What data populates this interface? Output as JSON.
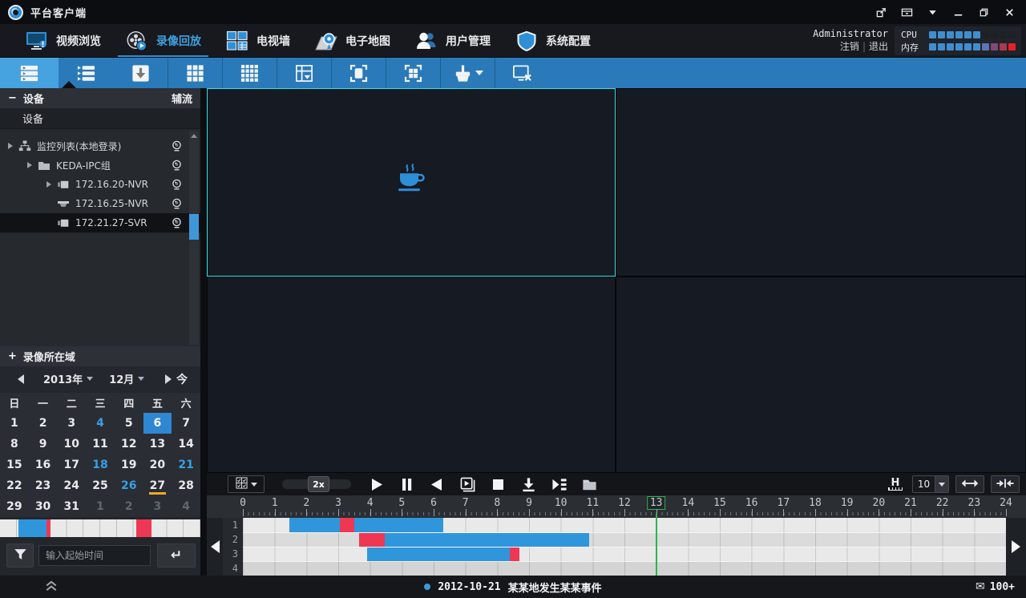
{
  "window": {
    "title": "平台客户端"
  },
  "titlebar": {
    "icons": [
      "popout",
      "panel-toggle",
      "caret-down",
      "minimize",
      "restore",
      "close"
    ]
  },
  "nav": {
    "tabs": [
      {
        "id": "video-browse",
        "label": "视频浏览",
        "icon": "monitor-icon",
        "active": false
      },
      {
        "id": "playback",
        "label": "录像回放",
        "icon": "film-reel-icon",
        "active": true
      },
      {
        "id": "tv-wall",
        "label": "电视墙",
        "icon": "tv-wall-icon",
        "active": false
      },
      {
        "id": "emap",
        "label": "电子地图",
        "icon": "map-pin-icon",
        "active": false
      },
      {
        "id": "user-mgmt",
        "label": "用户管理",
        "icon": "user-icon",
        "active": false
      },
      {
        "id": "sys-config",
        "label": "系统配置",
        "icon": "shield-icon",
        "active": false
      }
    ],
    "user": {
      "name": "Administrator",
      "logout": "注销",
      "divider": "|",
      "exit": "退出"
    },
    "perf": {
      "cpu_label": "CPU",
      "mem_label": "内存",
      "cpu_segments": [
        "#3e8ed0",
        "#3e8ed0",
        "#3e8ed0",
        "#3e8ed0",
        "#3e8ed0",
        "#3e8ed0",
        "#1d2025",
        "#1d2025",
        "#1d2025",
        "#1d2025"
      ],
      "mem_segments": [
        "#3e8ed0",
        "#3e8ed0",
        "#3e8ed0",
        "#3e8ed0",
        "#3e8ed0",
        "#3e8ed0",
        "#5b74b4",
        "#7e4a78",
        "#a63a50",
        "#e6202c"
      ]
    }
  },
  "toolbar": {
    "buttons": [
      {
        "name": "playback-list",
        "icon": "list-play-icon",
        "active": true,
        "dropdown": false
      },
      {
        "name": "event-list",
        "icon": "list-play2-icon",
        "active": false,
        "dropdown": false
      },
      {
        "name": "download-manager",
        "icon": "download-box-icon",
        "active": false,
        "dropdown": false
      },
      {
        "name": "grid-3x3",
        "icon": "grid9-icon",
        "active": false,
        "dropdown": false
      },
      {
        "name": "grid-4x4",
        "icon": "grid16-icon",
        "active": false,
        "dropdown": false
      },
      {
        "name": "grid-custom",
        "icon": "grid-dropdown-icon",
        "active": false,
        "dropdown": false
      },
      {
        "name": "single-screen",
        "icon": "single-screen-icon",
        "active": false,
        "dropdown": false
      },
      {
        "name": "multi-screen",
        "icon": "multi-screen-icon",
        "active": false,
        "dropdown": false
      },
      {
        "name": "brush-tool",
        "icon": "brush-icon",
        "active": false,
        "dropdown": true
      },
      {
        "name": "close-all-video",
        "icon": "screen-close-icon",
        "active": false,
        "dropdown": false
      }
    ]
  },
  "device_panel": {
    "title": "设备",
    "aux_stream": "辅流",
    "tab": "设备",
    "tree": [
      {
        "label": "监控列表(本地登录)",
        "level": 0,
        "expander": true,
        "icon": "network-icon",
        "selected": false
      },
      {
        "label": "KEDA-IPC组",
        "level": 1,
        "expander": true,
        "icon": "folder-icon",
        "selected": false
      },
      {
        "label": "172.16.20-NVR",
        "level": 2,
        "expander": true,
        "icon": "box-camera-icon",
        "selected": false
      },
      {
        "label": "172.16.25-NVR",
        "level": 2,
        "expander": false,
        "icon": "dome-camera-icon",
        "selected": false
      },
      {
        "label": "172.21.27-SVR",
        "level": 2,
        "expander": false,
        "icon": "box-camera-icon",
        "selected": true
      }
    ]
  },
  "record_domain": {
    "title": "录像所在域"
  },
  "calendar": {
    "year": "2013年",
    "month": "12月",
    "today_button": "今",
    "weekdays": [
      "日",
      "一",
      "二",
      "三",
      "四",
      "五",
      "六"
    ],
    "days": [
      {
        "d": "1"
      },
      {
        "d": "2"
      },
      {
        "d": "3"
      },
      {
        "d": "4",
        "rec": true
      },
      {
        "d": "5"
      },
      {
        "d": "6",
        "selected": true
      },
      {
        "d": "7"
      },
      {
        "d": "8"
      },
      {
        "d": "9"
      },
      {
        "d": "10"
      },
      {
        "d": "11"
      },
      {
        "d": "12"
      },
      {
        "d": "13"
      },
      {
        "d": "14"
      },
      {
        "d": "15"
      },
      {
        "d": "16"
      },
      {
        "d": "17"
      },
      {
        "d": "18",
        "rec": true
      },
      {
        "d": "19"
      },
      {
        "d": "20"
      },
      {
        "d": "21",
        "rec": true
      },
      {
        "d": "22"
      },
      {
        "d": "23"
      },
      {
        "d": "24"
      },
      {
        "d": "25"
      },
      {
        "d": "26",
        "rec": true
      },
      {
        "d": "27",
        "today": true
      },
      {
        "d": "28"
      },
      {
        "d": "29"
      },
      {
        "d": "30"
      },
      {
        "d": "31"
      },
      {
        "d": "1",
        "other": true
      },
      {
        "d": "2",
        "other": true
      },
      {
        "d": "3",
        "other": true
      },
      {
        "d": "4",
        "other": true
      }
    ]
  },
  "day_strip": {
    "segments": [
      {
        "start_pct": 9.2,
        "width_pct": 14.0,
        "type": "normal"
      },
      {
        "start_pct": 23.2,
        "width_pct": 2.0,
        "type": "alarm"
      },
      {
        "start_pct": 68.0,
        "width_pct": 7.5,
        "type": "alarm"
      }
    ]
  },
  "filter": {
    "placeholder": "输入起始时间"
  },
  "playback": {
    "speed_value": "2x",
    "transport": [
      "play",
      "pause",
      "reverse-play",
      "frame-step",
      "stop",
      "download",
      "next-event",
      "open-folder"
    ],
    "time_unit": "H",
    "split_count": "10"
  },
  "timeline": {
    "hour_start": 0,
    "hour_end": 24,
    "playhead_hour": 13,
    "colors": {
      "normal": "#2f96dc",
      "alarm": "#ee3753",
      "playhead": "#2ab54e"
    },
    "tracks": [
      {
        "num": "1",
        "segments": [
          {
            "from": 1.45,
            "to": 3.05,
            "type": "normal"
          },
          {
            "from": 3.05,
            "to": 3.5,
            "type": "alarm"
          },
          {
            "from": 3.5,
            "to": 6.3,
            "type": "normal"
          }
        ]
      },
      {
        "num": "2",
        "segments": [
          {
            "from": 3.65,
            "to": 4.45,
            "type": "alarm"
          },
          {
            "from": 4.45,
            "to": 10.9,
            "type": "normal"
          }
        ]
      },
      {
        "num": "3",
        "segments": [
          {
            "from": 3.9,
            "to": 8.4,
            "type": "normal"
          },
          {
            "from": 8.4,
            "to": 8.7,
            "type": "alarm"
          }
        ]
      },
      {
        "num": "4",
        "segments": []
      }
    ]
  },
  "status_bar": {
    "event_date": "2012-10-21",
    "event_text": "某某地发生某某事件",
    "unread_badge": "100+"
  }
}
